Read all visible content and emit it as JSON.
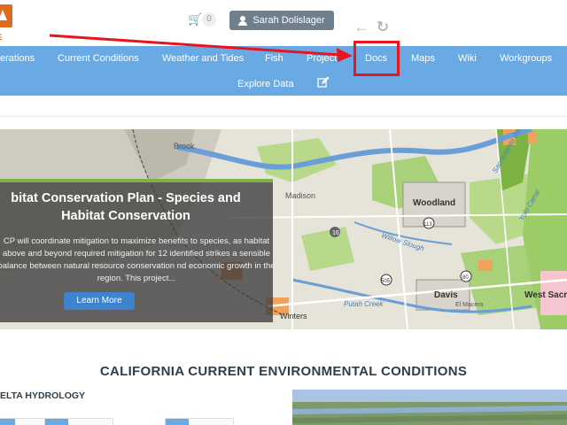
{
  "header": {
    "logo_text": "TE",
    "cart_count": "0",
    "user_name": "Sarah Dolislager"
  },
  "nav": {
    "row1": [
      "erations",
      "Current Conditions",
      "Weather and Tides",
      "Fish",
      "Projects",
      "Docs",
      "Maps",
      "Wiki",
      "Workgroups"
    ],
    "row2": [
      "Explore Data"
    ]
  },
  "hero": {
    "title": "bitat Conservation Plan - Species and Habitat Conservation",
    "text": "CP will coordinate mitigation to maximize benefits to species, as habitat above and beyond required mitigation for 12 identified strikes a sensible balance between natural resource conservation nd economic growth in the region. This project...",
    "button": "Learn More",
    "map_labels": [
      "Brook",
      "Madison",
      "Woodland",
      "Willow Slough",
      "Davis",
      "West Sacra",
      "Winters",
      "El Macero",
      "Yolo Canal",
      "Sacramento River",
      "Putah Creek"
    ],
    "route_labels": [
      "16",
      "113",
      "505",
      "80"
    ]
  },
  "main": {
    "section_title": "CALIFORNIA CURRENT ENVIRONMENTAL CONDITIONS",
    "subsection": "ELTA HYDROLOGY"
  },
  "colors": {
    "nav": "#6aaae4",
    "annotation": "#e8141e",
    "button": "#3f83cf"
  }
}
